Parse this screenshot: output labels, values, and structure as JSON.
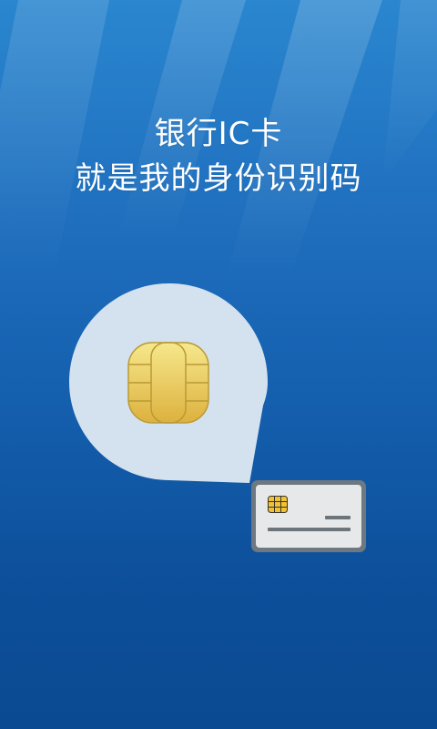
{
  "splash": {
    "headline_line1": "银行IC卡",
    "headline_line2": "就是我的身份识别码"
  },
  "icons": {
    "chip": "ic-chip-icon",
    "card": "bank-card-icon"
  },
  "colors": {
    "background_top": "#2a86cf",
    "background_bottom": "#0a4a92",
    "bubble": "#d4e2ef",
    "chip_gold": "#e9c652",
    "card_frame": "#6e7880",
    "card_face": "#e6e8ea"
  }
}
